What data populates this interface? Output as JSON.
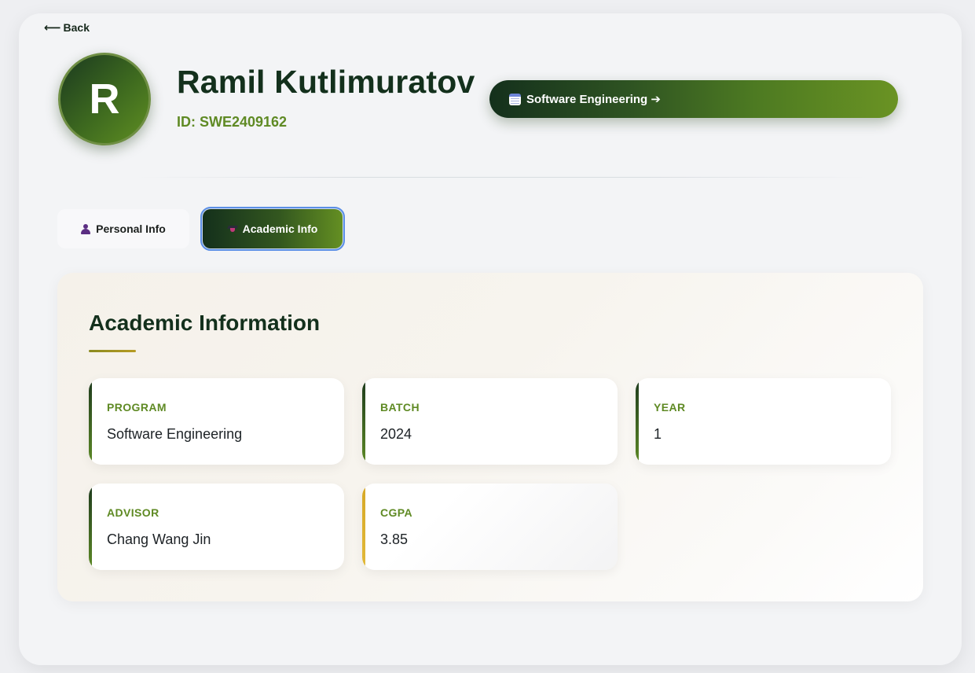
{
  "back": {
    "arrow": "⟵",
    "label": "Back"
  },
  "profile": {
    "avatar_initial": "R",
    "name": "Ramil Kutlimuratov",
    "id_text": "ID: SWE2409162",
    "program_button": {
      "icon": "calendar-icon",
      "label": "Software Engineering ➔"
    }
  },
  "tabs": [
    {
      "label": "Personal Info",
      "icon": "person-icon",
      "active": false
    },
    {
      "label": "Academic Info",
      "icon": "graduation-cap-icon",
      "active": true
    }
  ],
  "academic": {
    "title": "Academic Information",
    "fields": [
      {
        "label": "PROGRAM",
        "value": "Software Engineering"
      },
      {
        "label": "BATCH",
        "value": "2024"
      },
      {
        "label": "YEAR",
        "value": "1"
      },
      {
        "label": "ADVISOR",
        "value": "Chang Wang Jin"
      },
      {
        "label": "CGPA",
        "value": "3.85",
        "accent": "gold"
      }
    ]
  },
  "colors": {
    "brand_dark": "#13301c",
    "brand_green": "#5f8a24",
    "accent_gold": "#d6a826",
    "focus_ring": "#5b8fe6"
  }
}
